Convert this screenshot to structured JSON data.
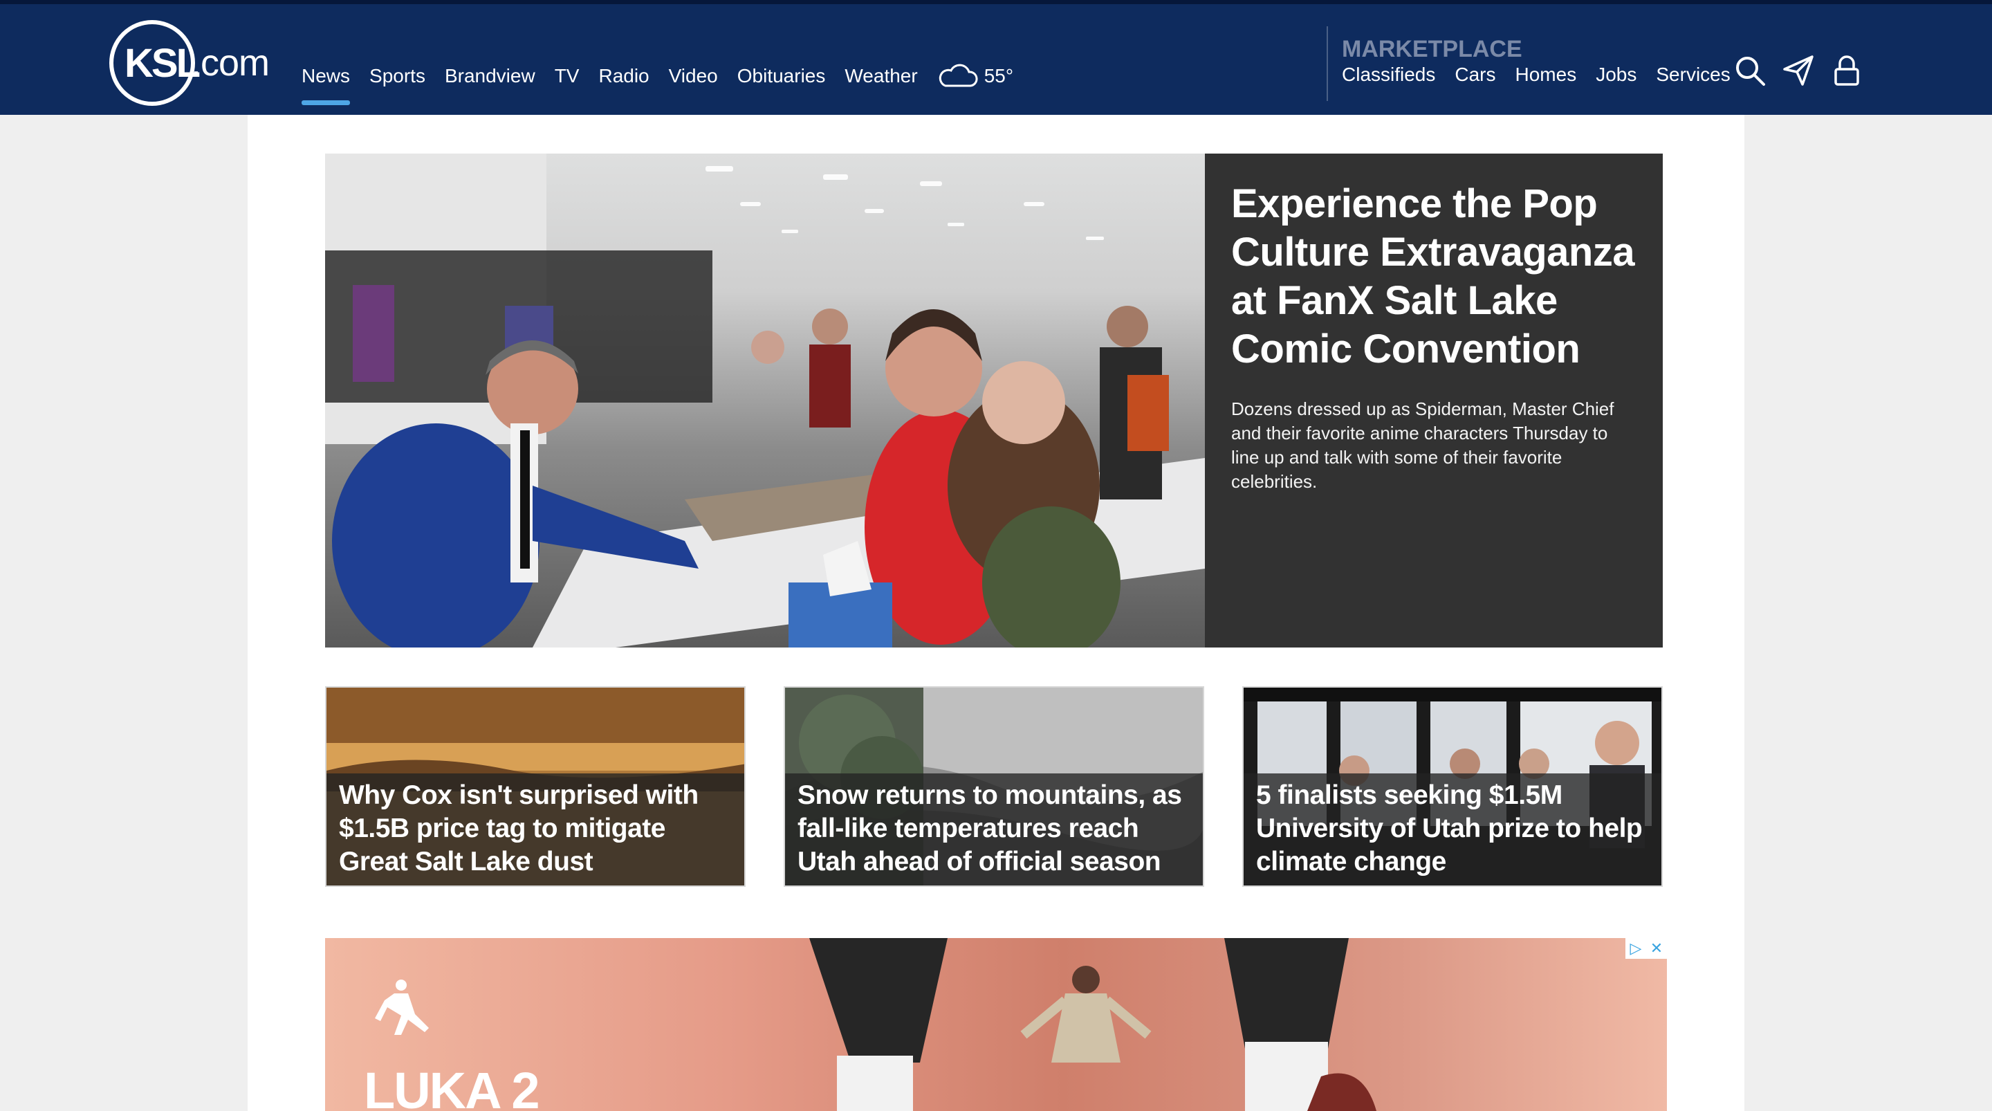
{
  "header": {
    "logo_text": "KSL",
    "logo_suffix": ".com",
    "nav": [
      {
        "label": "News",
        "active": true
      },
      {
        "label": "Sports"
      },
      {
        "label": "Brandview"
      },
      {
        "label": "TV"
      },
      {
        "label": "Radio"
      },
      {
        "label": "Video"
      },
      {
        "label": "Obituaries"
      },
      {
        "label": "Weather"
      }
    ],
    "weather_temp": "55°",
    "weather_icon": "cloud-icon",
    "marketplace_title": "MARKETPLACE",
    "marketplace_links": [
      "Classifieds",
      "Cars",
      "Homes",
      "Jobs",
      "Services"
    ],
    "icons": [
      "search-icon",
      "send-icon",
      "user-lock-icon"
    ]
  },
  "hero": {
    "title": "Experience the Pop Culture Extravaganza at FanX Salt Lake Comic Convention",
    "summary": "Dozens dressed up as Spiderman, Master Chief and their favorite anime characters Thursday to line up and talk with some of their favorite celebrities."
  },
  "cards": [
    {
      "title": "Why Cox isn't surprised with $1.5B price tag to mitigate Great Salt Lake dust"
    },
    {
      "title": "Snow returns to mountains, as fall-like temperatures reach Utah ahead of official season"
    },
    {
      "title": "5 finalists seeking $1.5M University of Utah prize to help climate change"
    }
  ],
  "ad": {
    "brand_text": "LUKA 2",
    "badge_play": "▷",
    "badge_close": "✕"
  },
  "colors": {
    "header_bg": "#0e2b5e",
    "accent": "#4ea6e6",
    "hero_panel": "#323232"
  }
}
